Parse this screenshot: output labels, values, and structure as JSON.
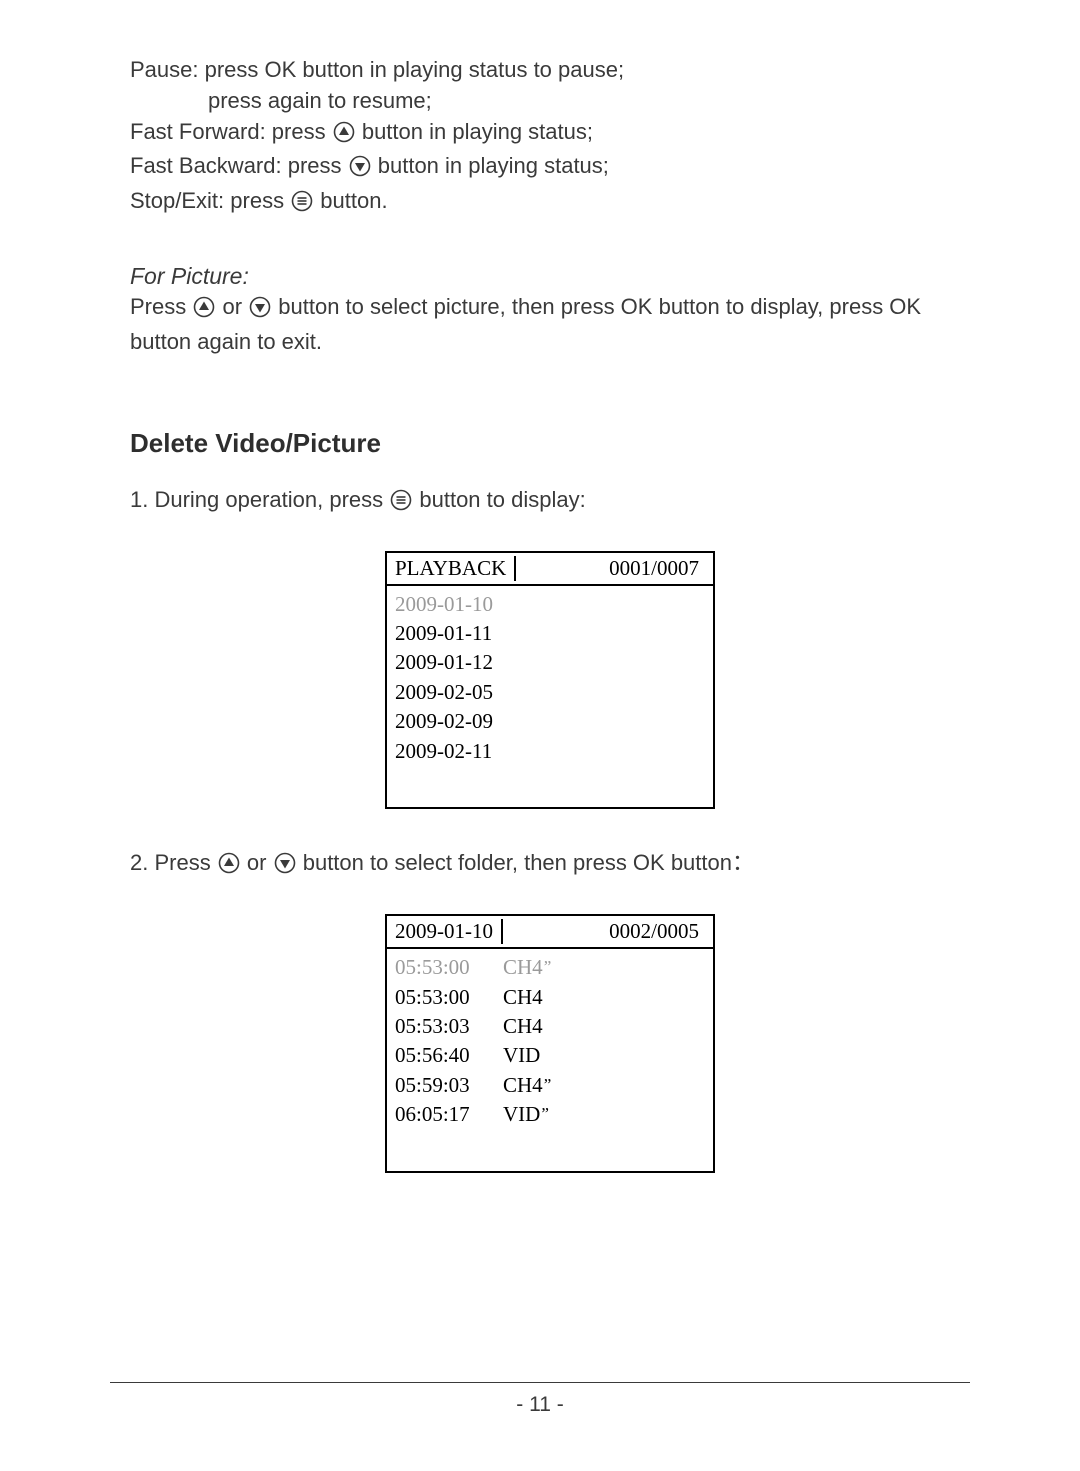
{
  "intro": {
    "pause_line1": "Pause: press OK button in playing status to pause;",
    "pause_line2": "press again to resume;",
    "ff_prefix": "Fast Forward: press ",
    "ff_suffix": " button in playing status;",
    "fb_prefix": "Fast Backward: press ",
    "fb_suffix": " button in playing status;",
    "stop_prefix": "Stop/Exit: press ",
    "stop_suffix": " button."
  },
  "for_picture": {
    "heading": "For Picture:",
    "line_prefix": "Press ",
    "line_mid": " or ",
    "line_suffix": " button to select picture, then press OK button to display, press OK button again to exit."
  },
  "section_title": "Delete Video/Picture",
  "step1": {
    "prefix": "1. During operation, press ",
    "suffix": " button to display:"
  },
  "screen1": {
    "title": "PLAYBACK",
    "counter": "0001/0007",
    "rows": [
      {
        "text": "2009-01-10",
        "dim": true
      },
      {
        "text": "2009-01-11",
        "dim": false
      },
      {
        "text": "2009-01-12",
        "dim": false
      },
      {
        "text": "2009-02-05",
        "dim": false
      },
      {
        "text": "2009-02-09",
        "dim": false
      },
      {
        "text": "2009-02-11",
        "dim": false
      }
    ]
  },
  "step2": {
    "prefix": "2. Press ",
    "mid": " or ",
    "suffix": " button to select folder, then press OK button："
  },
  "screen2": {
    "title": "2009-01-10",
    "counter": "0002/0005",
    "rows": [
      {
        "time": "05:53:00",
        "type": "CH4",
        "mark": "”",
        "dim": true
      },
      {
        "time": "05:53:00",
        "type": "CH4",
        "mark": "",
        "dim": false
      },
      {
        "time": "05:53:03",
        "type": "CH4",
        "mark": "",
        "dim": false
      },
      {
        "time": "05:56:40",
        "type": "VID",
        "mark": "",
        "dim": false
      },
      {
        "time": "05:59:03",
        "type": "CH4",
        "mark": "”",
        "dim": false
      },
      {
        "time": "06:05:17",
        "type": "VID",
        "mark": "”",
        "dim": false
      }
    ]
  },
  "page_number": "- 11 -"
}
